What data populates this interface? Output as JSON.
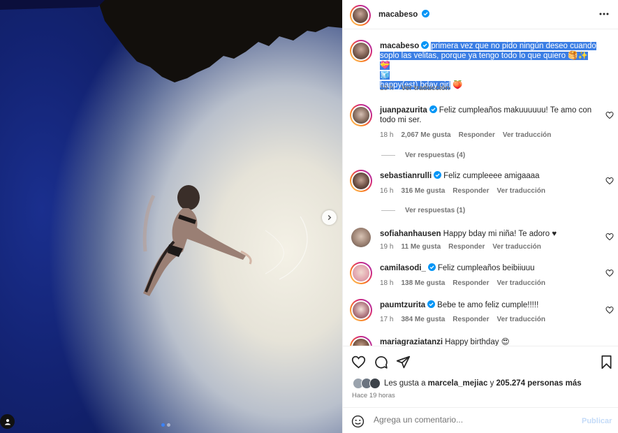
{
  "post": {
    "author": "macabeso",
    "caption_selected_1": "primera vez que no pido ningún deseo cuando soplo las velitas, porque ya tengo todo lo que quiero 🥞✨💝",
    "caption_selected_2": "🧊",
    "caption_selected_3": "happy(est) bday girl",
    "caption_emoji_tail": "🍑",
    "caption_time": "19 h",
    "caption_translate": "Ver traducción"
  },
  "comments": [
    {
      "user": "juanpazurita",
      "verified": true,
      "text": "Feliz cumpleaños makuuuuuu! Te amo con todo mi ser.",
      "time": "18 h",
      "likes": "2,067 Me gusta",
      "reply": "Responder",
      "translate": "Ver traducción",
      "replies": "Ver respuestas (4)"
    },
    {
      "user": "sebastianrulli",
      "verified": true,
      "text": "Feliz cumpleeee amigaaaa",
      "time": "16 h",
      "likes": "316 Me gusta",
      "reply": "Responder",
      "translate": "Ver traducción",
      "replies": "Ver respuestas (1)"
    },
    {
      "user": "sofiahanhausen",
      "verified": false,
      "text": "Happy bday mi niña! Te adoro ♥",
      "time": "19 h",
      "likes": "11 Me gusta",
      "reply": "Responder",
      "translate": "Ver traducción"
    },
    {
      "user": "camilasodi_",
      "verified": true,
      "text": "Feliz cumpleaños beibiiuuu",
      "time": "18 h",
      "likes": "138 Me gusta",
      "reply": "Responder",
      "translate": "Ver traducción"
    },
    {
      "user": "paumtzurita",
      "verified": true,
      "text": "Bebe te amo feliz cumple!!!!!",
      "time": "17 h",
      "likes": "384 Me gusta",
      "reply": "Responder",
      "translate": "Ver traducción"
    },
    {
      "user": "mariagraziatanzi",
      "verified": false,
      "text": "Happy birthday 😍",
      "time": "",
      "likes": "",
      "reply": "",
      "translate": ""
    }
  ],
  "likes": {
    "prefix": "Les gusta a",
    "first_user": "marcela_mejiac",
    "joiner": "y",
    "others": "205.274 personas más"
  },
  "posted": "Hace 19 horas",
  "compose": {
    "placeholder": "Agrega un comentario...",
    "post_label": "Publicar"
  },
  "colors": {
    "verified": "#0095f6",
    "selection": "#3b7ee4",
    "muted": "#737373",
    "post_disabled": "#c4dbf8"
  },
  "icons": [
    "more-options-icon",
    "verified-badge-icon",
    "heart-icon",
    "comment-icon",
    "share-icon",
    "bookmark-icon",
    "emoji-icon",
    "chevron-right-icon",
    "user-tag-icon"
  ]
}
